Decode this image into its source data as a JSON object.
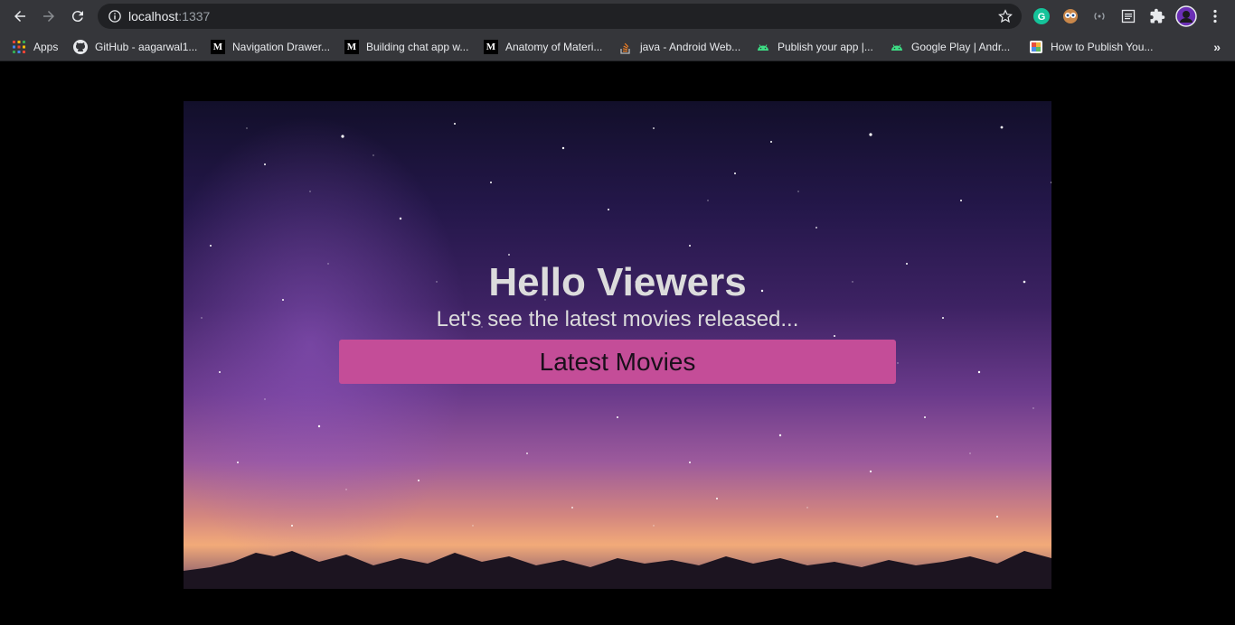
{
  "browser": {
    "url_host": "localhost",
    "url_port": ":1337"
  },
  "bookmarks": {
    "items": [
      {
        "label": "Apps",
        "icon": "apps-grid-icon"
      },
      {
        "label": "GitHub - aagarwal1...",
        "icon": "github-icon"
      },
      {
        "label": "Navigation Drawer...",
        "icon": "medium-icon"
      },
      {
        "label": "Building chat app w...",
        "icon": "medium-icon"
      },
      {
        "label": "Anatomy of Materi...",
        "icon": "medium-icon"
      },
      {
        "label": "java - Android Web...",
        "icon": "stackoverflow-icon"
      },
      {
        "label": "Publish your app |...",
        "icon": "android-icon"
      },
      {
        "label": "Google Play | Andr...",
        "icon": "android-icon"
      },
      {
        "label": "How to Publish You...",
        "icon": "site-icon"
      }
    ],
    "more": "»"
  },
  "hero": {
    "title": "Hello Viewers",
    "subtitle": "Let's see the latest movies released...",
    "button_label": "Latest Movies"
  },
  "colors": {
    "button_bg": "#c44d98",
    "text_light": "#dcdcdc"
  }
}
